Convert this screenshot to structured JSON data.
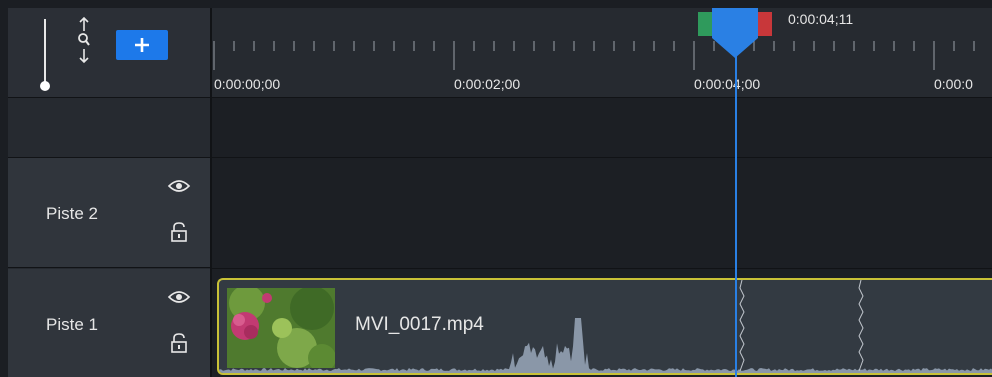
{
  "zoom": {
    "slider_level": 0.0,
    "add_label": "+"
  },
  "tracks": [
    {
      "name": "Piste 2"
    },
    {
      "name": "Piste 1"
    }
  ],
  "ruler": {
    "ticks": [
      "0:00:00;00",
      "0:00:02;00",
      "0:00:04;00",
      "0:00:0"
    ],
    "current_time": "0:00:04;11"
  },
  "clip": {
    "name": "MVI_0017.mp4"
  },
  "colors": {
    "accent": "#1d79ea",
    "clip_border": "#c9c237",
    "playhead": "#2a80e4",
    "in_marker": "#2f9a5c",
    "out_marker": "#c8373a"
  }
}
